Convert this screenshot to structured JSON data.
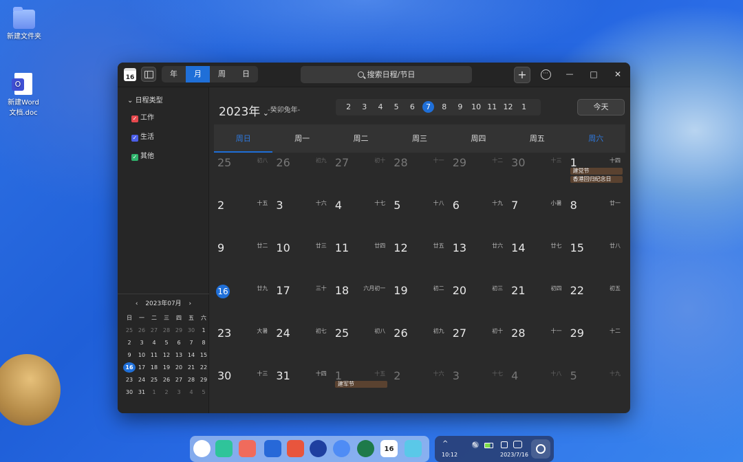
{
  "desktop": {
    "icons": [
      {
        "name": "新建文件夹"
      },
      {
        "name": "新建Word\n文档.doc"
      }
    ]
  },
  "window": {
    "app_icon_text": "16",
    "view_tabs": [
      "年",
      "月",
      "周",
      "日"
    ],
    "active_view": "月",
    "search_placeholder": "搜索日程/节日",
    "add_label": "+",
    "more_label": "···",
    "min_label": "—",
    "max_label": "□",
    "close_label": "✕"
  },
  "sidebar": {
    "category_title": "日程类型",
    "categories": [
      {
        "label": "工作",
        "color": "#e5484d"
      },
      {
        "label": "生活",
        "color": "#4b5ee8"
      },
      {
        "label": "其他",
        "color": "#2fb36b"
      }
    ],
    "mini_calendar": {
      "title": "2023年07月",
      "prev": "‹",
      "next": "›",
      "weekdays": [
        "日",
        "一",
        "二",
        "三",
        "四",
        "五",
        "六"
      ],
      "days": [
        [
          "25",
          "26",
          "27",
          "28",
          "29",
          "30",
          "1"
        ],
        [
          "2",
          "3",
          "4",
          "5",
          "6",
          "7",
          "8"
        ],
        [
          "9",
          "10",
          "11",
          "12",
          "13",
          "14",
          "15"
        ],
        [
          "16",
          "17",
          "18",
          "19",
          "20",
          "21",
          "22"
        ],
        [
          "23",
          "24",
          "25",
          "26",
          "27",
          "28",
          "29"
        ],
        [
          "30",
          "31",
          "1",
          "2",
          "3",
          "4",
          "5"
        ]
      ],
      "today": "16"
    }
  },
  "main": {
    "year": "2023年",
    "lunar_year": "-癸卯兔年-",
    "months": [
      "2",
      "3",
      "4",
      "5",
      "6",
      "7",
      "8",
      "9",
      "10",
      "11",
      "12",
      "1"
    ],
    "current_month": "7",
    "today_button": "今天",
    "weekdays": [
      "周日",
      "周一",
      "周二",
      "周三",
      "周四",
      "周五",
      "周六"
    ],
    "weeks": [
      [
        {
          "d": "25",
          "l": "初八",
          "dim": true
        },
        {
          "d": "26",
          "l": "初九",
          "dim": true
        },
        {
          "d": "27",
          "l": "初十",
          "dim": true
        },
        {
          "d": "28",
          "l": "十一",
          "dim": true
        },
        {
          "d": "29",
          "l": "十二",
          "dim": true
        },
        {
          "d": "30",
          "l": "十三",
          "dim": true
        },
        {
          "d": "1",
          "l": "十四",
          "events": [
            "建党节",
            "香港回归纪念日"
          ]
        }
      ],
      [
        {
          "d": "2",
          "l": "十五"
        },
        {
          "d": "3",
          "l": "十六"
        },
        {
          "d": "4",
          "l": "十七"
        },
        {
          "d": "5",
          "l": "十八"
        },
        {
          "d": "6",
          "l": "十九"
        },
        {
          "d": "7",
          "l": "小暑"
        },
        {
          "d": "8",
          "l": "廿一"
        }
      ],
      [
        {
          "d": "9",
          "l": "廿二"
        },
        {
          "d": "10",
          "l": "廿三"
        },
        {
          "d": "11",
          "l": "廿四"
        },
        {
          "d": "12",
          "l": "廿五"
        },
        {
          "d": "13",
          "l": "廿六"
        },
        {
          "d": "14",
          "l": "廿七"
        },
        {
          "d": "15",
          "l": "廿八"
        }
      ],
      [
        {
          "d": "16",
          "l": "廿九",
          "today": true
        },
        {
          "d": "17",
          "l": "三十"
        },
        {
          "d": "18",
          "l": "六月初一"
        },
        {
          "d": "19",
          "l": "初二"
        },
        {
          "d": "20",
          "l": "初三"
        },
        {
          "d": "21",
          "l": "初四"
        },
        {
          "d": "22",
          "l": "初五"
        }
      ],
      [
        {
          "d": "23",
          "l": "大暑"
        },
        {
          "d": "24",
          "l": "初七"
        },
        {
          "d": "25",
          "l": "初八"
        },
        {
          "d": "26",
          "l": "初九"
        },
        {
          "d": "27",
          "l": "初十"
        },
        {
          "d": "28",
          "l": "十一"
        },
        {
          "d": "29",
          "l": "十二"
        }
      ],
      [
        {
          "d": "30",
          "l": "十三"
        },
        {
          "d": "31",
          "l": "十四"
        },
        {
          "d": "1",
          "l": "十五",
          "dim": true,
          "events": [
            "建军节"
          ]
        },
        {
          "d": "2",
          "l": "十六",
          "dim": true
        },
        {
          "d": "3",
          "l": "十七",
          "dim": true
        },
        {
          "d": "4",
          "l": "十八",
          "dim": true
        },
        {
          "d": "5",
          "l": "十九",
          "dim": true
        }
      ]
    ]
  },
  "taskbar": {
    "time": "10:12",
    "date": "2023/7/16",
    "tray_arrow": "^",
    "calendar_icon_text": "16"
  }
}
